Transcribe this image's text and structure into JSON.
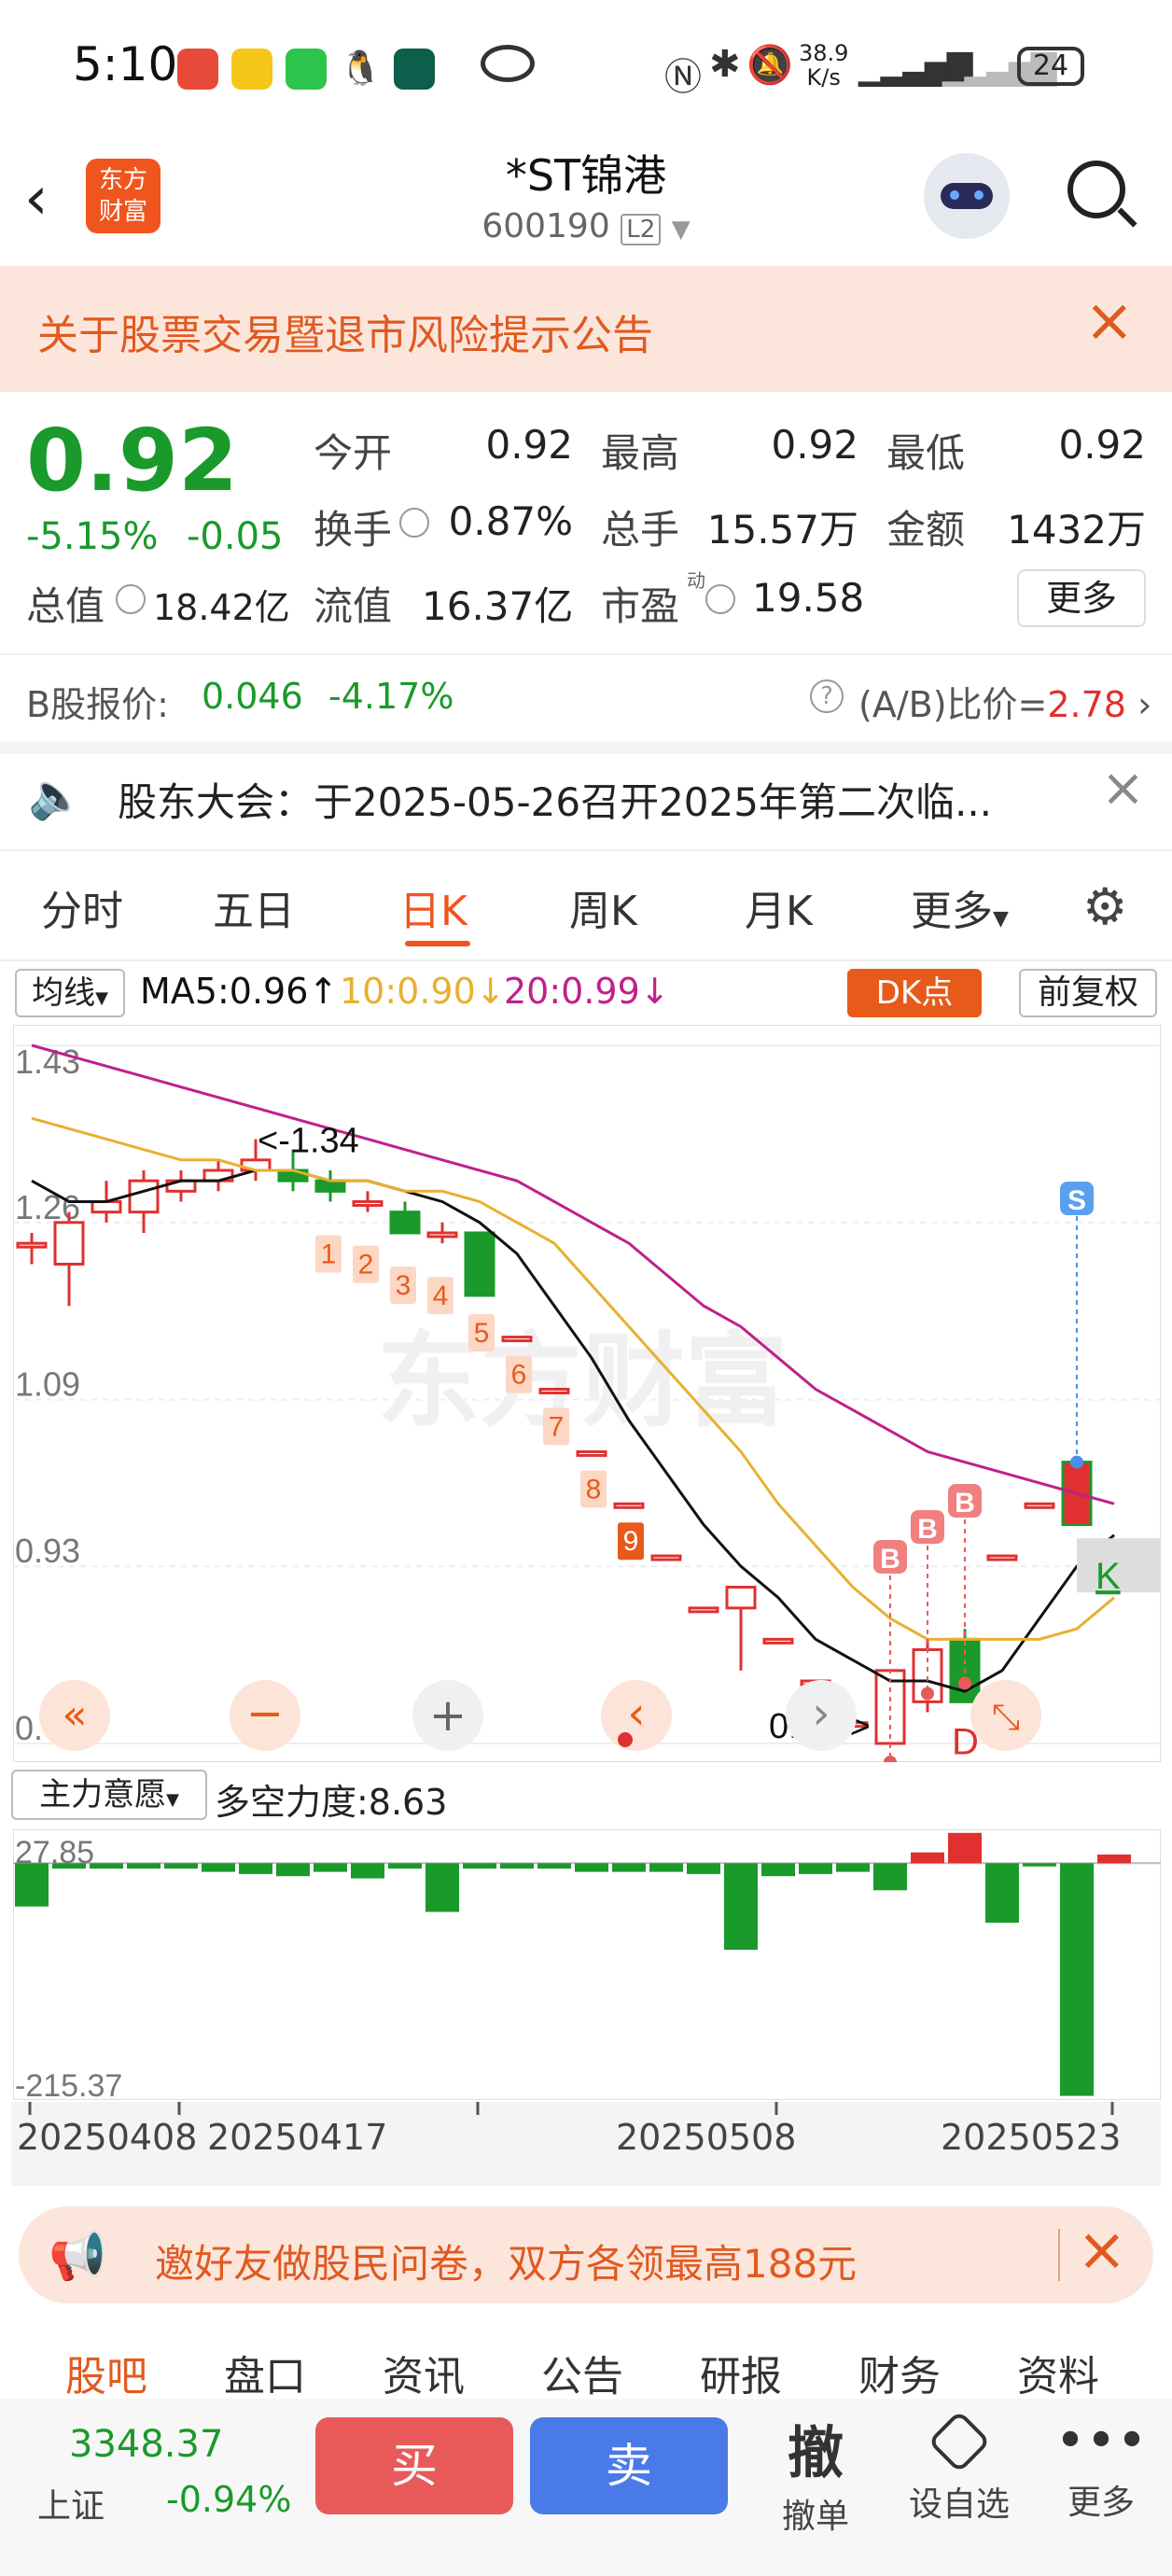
{
  "status": {
    "time": "5:10",
    "net_speed": "38.9",
    "net_unit": "K/s",
    "battery": "24"
  },
  "header": {
    "title": "*ST锦港",
    "code": "600190",
    "level": "L2",
    "logo_line1": "东方",
    "logo_line2": "财富"
  },
  "notice": {
    "text": "关于股票交易暨退市风险提示公告"
  },
  "quote": {
    "price": "0.92",
    "change_pct": "-5.15%",
    "change": "-0.05",
    "open_label": "今开",
    "open": "0.92",
    "high_label": "最高",
    "high": "0.92",
    "low_label": "最低",
    "low": "0.92",
    "turnover_label": "换手",
    "turnover": "0.87%",
    "volume_label": "总手",
    "volume": "15.57万",
    "amount_label": "金额",
    "amount": "1432万",
    "mcap_label": "总值",
    "mcap": "18.42亿",
    "float_label": "流值",
    "float": "16.37亿",
    "pe_label": "市盈",
    "pe_sup": "动",
    "pe": "19.58",
    "more": "更多"
  },
  "bshare": {
    "label": "B股报价:",
    "price": "0.046",
    "pct": "-4.17%",
    "ratio_label": "(A/B)比价=",
    "ratio": "2.78"
  },
  "announce": {
    "text": "股东大会：于2025-05-26召开2025年第二次临..."
  },
  "tabs": [
    "分时",
    "五日",
    "日K",
    "周K",
    "月K",
    "更多"
  ],
  "active_tab": "日K",
  "indicators": {
    "ma_select": "均线",
    "ma5": "MA5:0.96",
    "ma10": "10:0.90",
    "ma20": "20:0.99",
    "dk": "DK点",
    "adjust": "前复权"
  },
  "chart": {
    "y_ticks": [
      "1.43",
      "1.26",
      "1.09",
      "0.93",
      "0.76"
    ],
    "high_marker": "<-1.34",
    "low_marker": "0.76->",
    "seq_labels": [
      "1",
      "2",
      "3",
      "4",
      "5",
      "6",
      "7",
      "8",
      "9"
    ],
    "b_label": "B",
    "s_label": "S",
    "d_label": "D",
    "k_label": "K",
    "watermark": "东方财富"
  },
  "chart_data": {
    "type": "candlestick",
    "candles": [
      {
        "o": 1.24,
        "h": 1.25,
        "l": 1.22,
        "c": 1.24
      },
      {
        "o": 1.22,
        "h": 1.27,
        "l": 1.18,
        "c": 1.26
      },
      {
        "o": 1.27,
        "h": 1.3,
        "l": 1.26,
        "c": 1.28
      },
      {
        "o": 1.27,
        "h": 1.31,
        "l": 1.25,
        "c": 1.3
      },
      {
        "o": 1.29,
        "h": 1.31,
        "l": 1.28,
        "c": 1.3
      },
      {
        "o": 1.3,
        "h": 1.32,
        "l": 1.29,
        "c": 1.31
      },
      {
        "o": 1.31,
        "h": 1.34,
        "l": 1.3,
        "c": 1.32
      },
      {
        "o": 1.31,
        "h": 1.33,
        "l": 1.29,
        "c": 1.3
      },
      {
        "o": 1.3,
        "h": 1.31,
        "l": 1.28,
        "c": 1.29
      },
      {
        "o": 1.28,
        "h": 1.29,
        "l": 1.27,
        "c": 1.28
      },
      {
        "o": 1.27,
        "h": 1.28,
        "l": 1.25,
        "c": 1.25
      },
      {
        "o": 1.25,
        "h": 1.26,
        "l": 1.24,
        "c": 1.25
      },
      {
        "o": 1.25,
        "h": 1.25,
        "l": 1.19,
        "c": 1.19
      },
      {
        "o": 1.15,
        "h": 1.15,
        "l": 1.15,
        "c": 1.15
      },
      {
        "o": 1.1,
        "h": 1.1,
        "l": 1.1,
        "c": 1.1
      },
      {
        "o": 1.04,
        "h": 1.04,
        "l": 1.04,
        "c": 1.04
      },
      {
        "o": 0.99,
        "h": 0.99,
        "l": 0.99,
        "c": 0.99
      },
      {
        "o": 0.94,
        "h": 0.94,
        "l": 0.94,
        "c": 0.94
      },
      {
        "o": 0.89,
        "h": 0.89,
        "l": 0.89,
        "c": 0.89
      },
      {
        "o": 0.89,
        "h": 0.91,
        "l": 0.83,
        "c": 0.91
      },
      {
        "o": 0.86,
        "h": 0.86,
        "l": 0.86,
        "c": 0.86
      },
      {
        "o": 0.82,
        "h": 0.82,
        "l": 0.82,
        "c": 0.82
      },
      {
        "o": 0.78,
        "h": 0.78,
        "l": 0.78,
        "c": 0.78
      },
      {
        "o": 0.76,
        "h": 0.83,
        "l": 0.76,
        "c": 0.83
      },
      {
        "o": 0.8,
        "h": 0.86,
        "l": 0.79,
        "c": 0.85
      },
      {
        "o": 0.86,
        "h": 0.87,
        "l": 0.8,
        "c": 0.8
      },
      {
        "o": 0.94,
        "h": 0.94,
        "l": 0.94,
        "c": 0.94
      },
      {
        "o": 0.99,
        "h": 0.99,
        "l": 0.99,
        "c": 0.99
      },
      {
        "o": 1.03,
        "h": 1.03,
        "l": 0.97,
        "c": 0.97
      },
      {
        "o": 0.92,
        "h": 0.92,
        "l": 0.92,
        "c": 0.92
      }
    ],
    "ma5": [
      1.3,
      1.28,
      1.28,
      1.29,
      1.3,
      1.3,
      1.31,
      1.31,
      1.3,
      1.3,
      1.29,
      1.28,
      1.26,
      1.23,
      1.18,
      1.13,
      1.07,
      1.02,
      0.97,
      0.93,
      0.9,
      0.86,
      0.84,
      0.82,
      0.82,
      0.81,
      0.83,
      0.88,
      0.93,
      0.96
    ],
    "ma10": [
      1.36,
      1.35,
      1.34,
      1.33,
      1.32,
      1.32,
      1.31,
      1.31,
      1.3,
      1.3,
      1.29,
      1.29,
      1.28,
      1.26,
      1.24,
      1.2,
      1.16,
      1.12,
      1.08,
      1.04,
      0.99,
      0.95,
      0.91,
      0.88,
      0.86,
      0.86,
      0.86,
      0.86,
      0.87,
      0.9
    ],
    "ma20": [
      1.43,
      1.42,
      1.41,
      1.4,
      1.39,
      1.38,
      1.37,
      1.36,
      1.35,
      1.34,
      1.33,
      1.32,
      1.31,
      1.3,
      1.28,
      1.26,
      1.24,
      1.21,
      1.18,
      1.16,
      1.13,
      1.1,
      1.08,
      1.06,
      1.04,
      1.03,
      1.02,
      1.01,
      1.0,
      0.99
    ],
    "ylim": [
      0.76,
      1.43
    ]
  },
  "sub": {
    "select": "主力意愿",
    "label": "多空力度:8.63",
    "top": "27.85",
    "bottom": "-215.37"
  },
  "sub_data": [
    -40,
    -5,
    -5,
    -5,
    -5,
    -8,
    -10,
    -12,
    -8,
    -14,
    -5,
    -45,
    -5,
    -5,
    -5,
    -8,
    -8,
    -8,
    -10,
    -80,
    -12,
    -10,
    -8,
    -25,
    10,
    28,
    -55,
    -3,
    -215,
    8
  ],
  "dates": [
    "20250408",
    "20250417",
    "20250508",
    "20250523"
  ],
  "banner": {
    "text": "邀好友做股民问卷，双方各领最高188元"
  },
  "bottom_tabs": [
    "股吧",
    "盘口",
    "资讯",
    "公告",
    "研报",
    "财务",
    "资料"
  ],
  "active_bottom_tab": "股吧",
  "index": {
    "value": "3348.37",
    "name": "上证",
    "pct": "-0.94%"
  },
  "actions": {
    "buy": "买",
    "sell": "卖",
    "cancel_char": "撤",
    "cancel": "撤单",
    "watch": "设自选",
    "more": "更多"
  },
  "colors": {
    "up": "#e03030",
    "down": "#1a9a2a",
    "ma5": "#111111",
    "ma10": "#e8b030",
    "ma20": "#c0208a",
    "accent": "#f0551e",
    "buy": "#e85a5a",
    "sell": "#4a7ae8"
  }
}
